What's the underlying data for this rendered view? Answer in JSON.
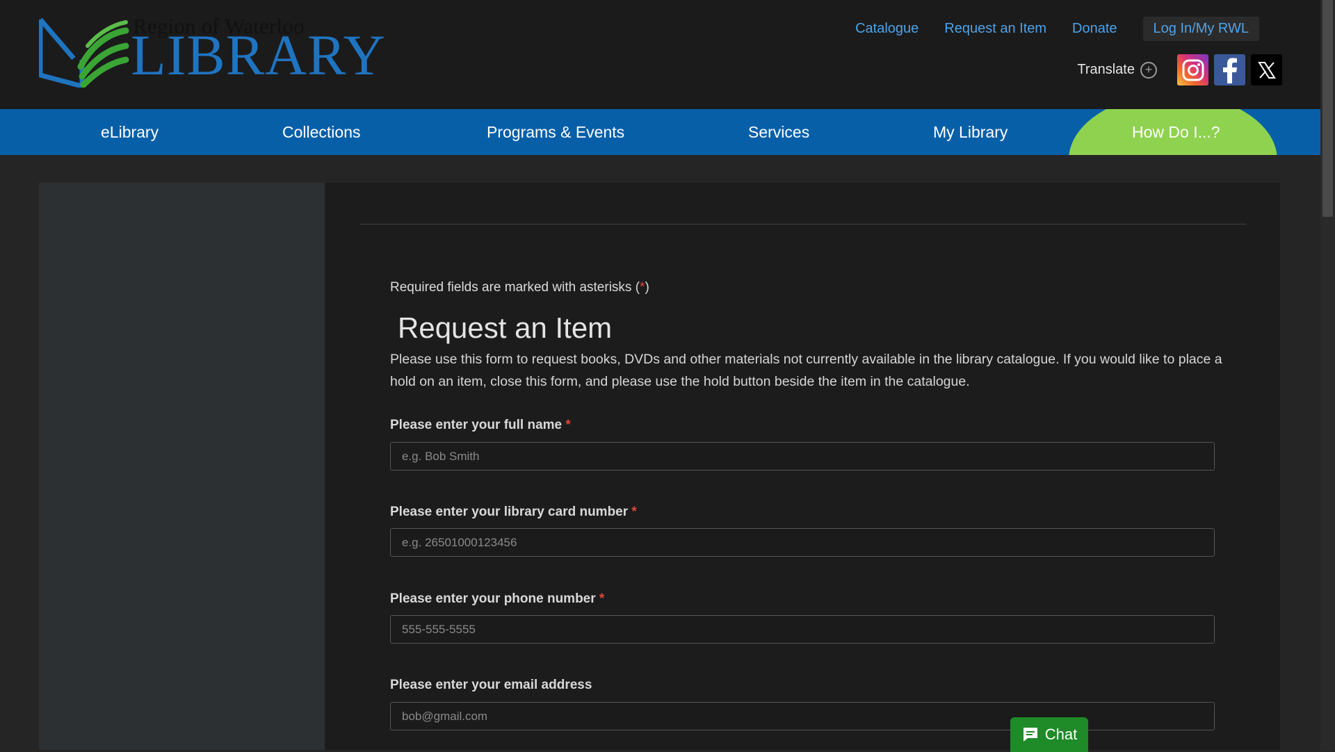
{
  "logo": {
    "line1": "Region of Waterloo",
    "line2": "LIBRARY"
  },
  "toplinks": [
    {
      "label": "Catalogue"
    },
    {
      "label": "Request an Item"
    },
    {
      "label": "Donate"
    },
    {
      "label": "Log In/My RWL"
    }
  ],
  "utility": {
    "translate": "Translate",
    "social": [
      "instagram-icon",
      "facebook-icon",
      "x-icon"
    ]
  },
  "nav": {
    "items": [
      {
        "label": "eLibrary"
      },
      {
        "label": "Collections"
      },
      {
        "label": "Programs & Events"
      },
      {
        "label": "Services"
      },
      {
        "label": "My Library"
      }
    ],
    "howdo": "How Do I...?"
  },
  "form": {
    "required_note_prefix": "Required fields are marked with asterisks (",
    "required_note_star": "*",
    "required_note_suffix": ")",
    "title": "Request an Item",
    "intro": "Please use this form to request books, DVDs and other materials not currently available in the library catalogue. If you would like to place a hold on an item, close this form, and please use the hold button beside the item in the catalogue.",
    "fields": [
      {
        "label": "Please enter your full name",
        "required": "*",
        "placeholder": "e.g. Bob Smith"
      },
      {
        "label": "Please enter your library card number",
        "required": "*",
        "placeholder": "e.g. 26501000123456"
      },
      {
        "label": "Please enter your phone number",
        "required": "*",
        "placeholder": "555-555-5555"
      },
      {
        "label": "Please enter your email address",
        "required": "",
        "placeholder": "bob@gmail.com"
      }
    ]
  },
  "chat": {
    "label": "Chat"
  },
  "colors": {
    "nav_bg": "#075fa8",
    "howdo_bg": "#8fd24f",
    "link": "#4da3ea",
    "chat_bg": "#1e8a28",
    "required": "#e0443b"
  }
}
